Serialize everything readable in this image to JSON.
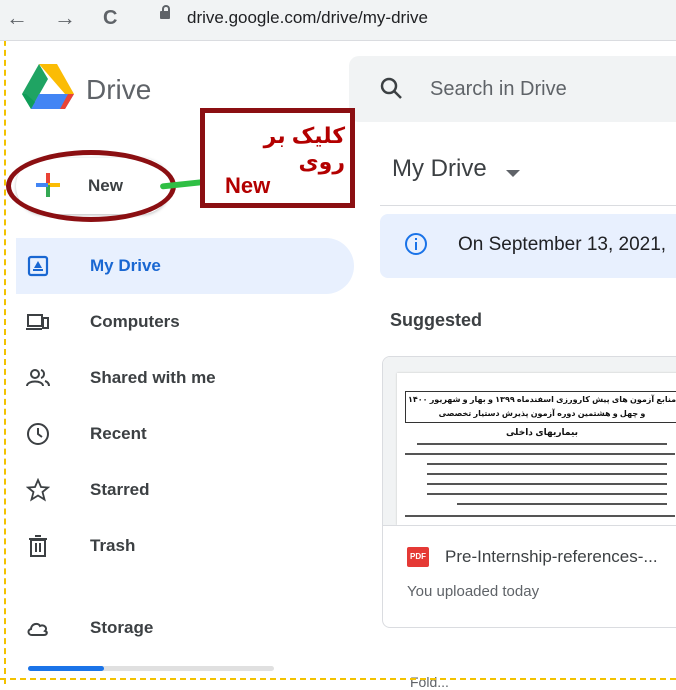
{
  "browser": {
    "back_icon": "←",
    "forward_icon": "→",
    "reload_icon": "C",
    "url": "drive.google.com/drive/my-drive"
  },
  "header": {
    "app_name": "Drive",
    "search_placeholder": "Search in Drive"
  },
  "new_button": {
    "label": "New"
  },
  "annotation": {
    "text_fa": "کلیک بر روی",
    "text_en": "New",
    "color": "#8b0f12"
  },
  "sidebar": {
    "items": [
      {
        "label": "My Drive",
        "icon": "my-drive-icon",
        "active": true
      },
      {
        "label": "Computers",
        "icon": "computers-icon"
      },
      {
        "label": "Shared with me",
        "icon": "shared-icon"
      },
      {
        "label": "Recent",
        "icon": "clock-icon"
      },
      {
        "label": "Starred",
        "icon": "star-icon"
      },
      {
        "label": "Trash",
        "icon": "trash-icon"
      },
      {
        "label": "Storage",
        "icon": "cloud-icon"
      }
    ],
    "storage_used_fraction": 0.31
  },
  "main": {
    "title": "My Drive",
    "banner_text": "On September 13, 2021,",
    "suggested_label": "Suggested",
    "file": {
      "name": "Pre-Internship-references-...",
      "subtitle": "You uploaded today",
      "badge": "PDF",
      "thumb_title_1": "منابع آزمون های پیش کارورزی اسفندماه ۱۳۹۹ و بهار و شهریور ۱۴۰۰",
      "thumb_title_2": "و چهل و هشتمین دوره آزمون پذیرش دستیار تخصصی",
      "thumb_heading": "بیماریهای داخلی"
    },
    "bottom_cutoff": "Fold..."
  },
  "colors": {
    "accent": "#1a73e8",
    "active_bg": "#e8f0fe",
    "guide": "#f2c200"
  }
}
